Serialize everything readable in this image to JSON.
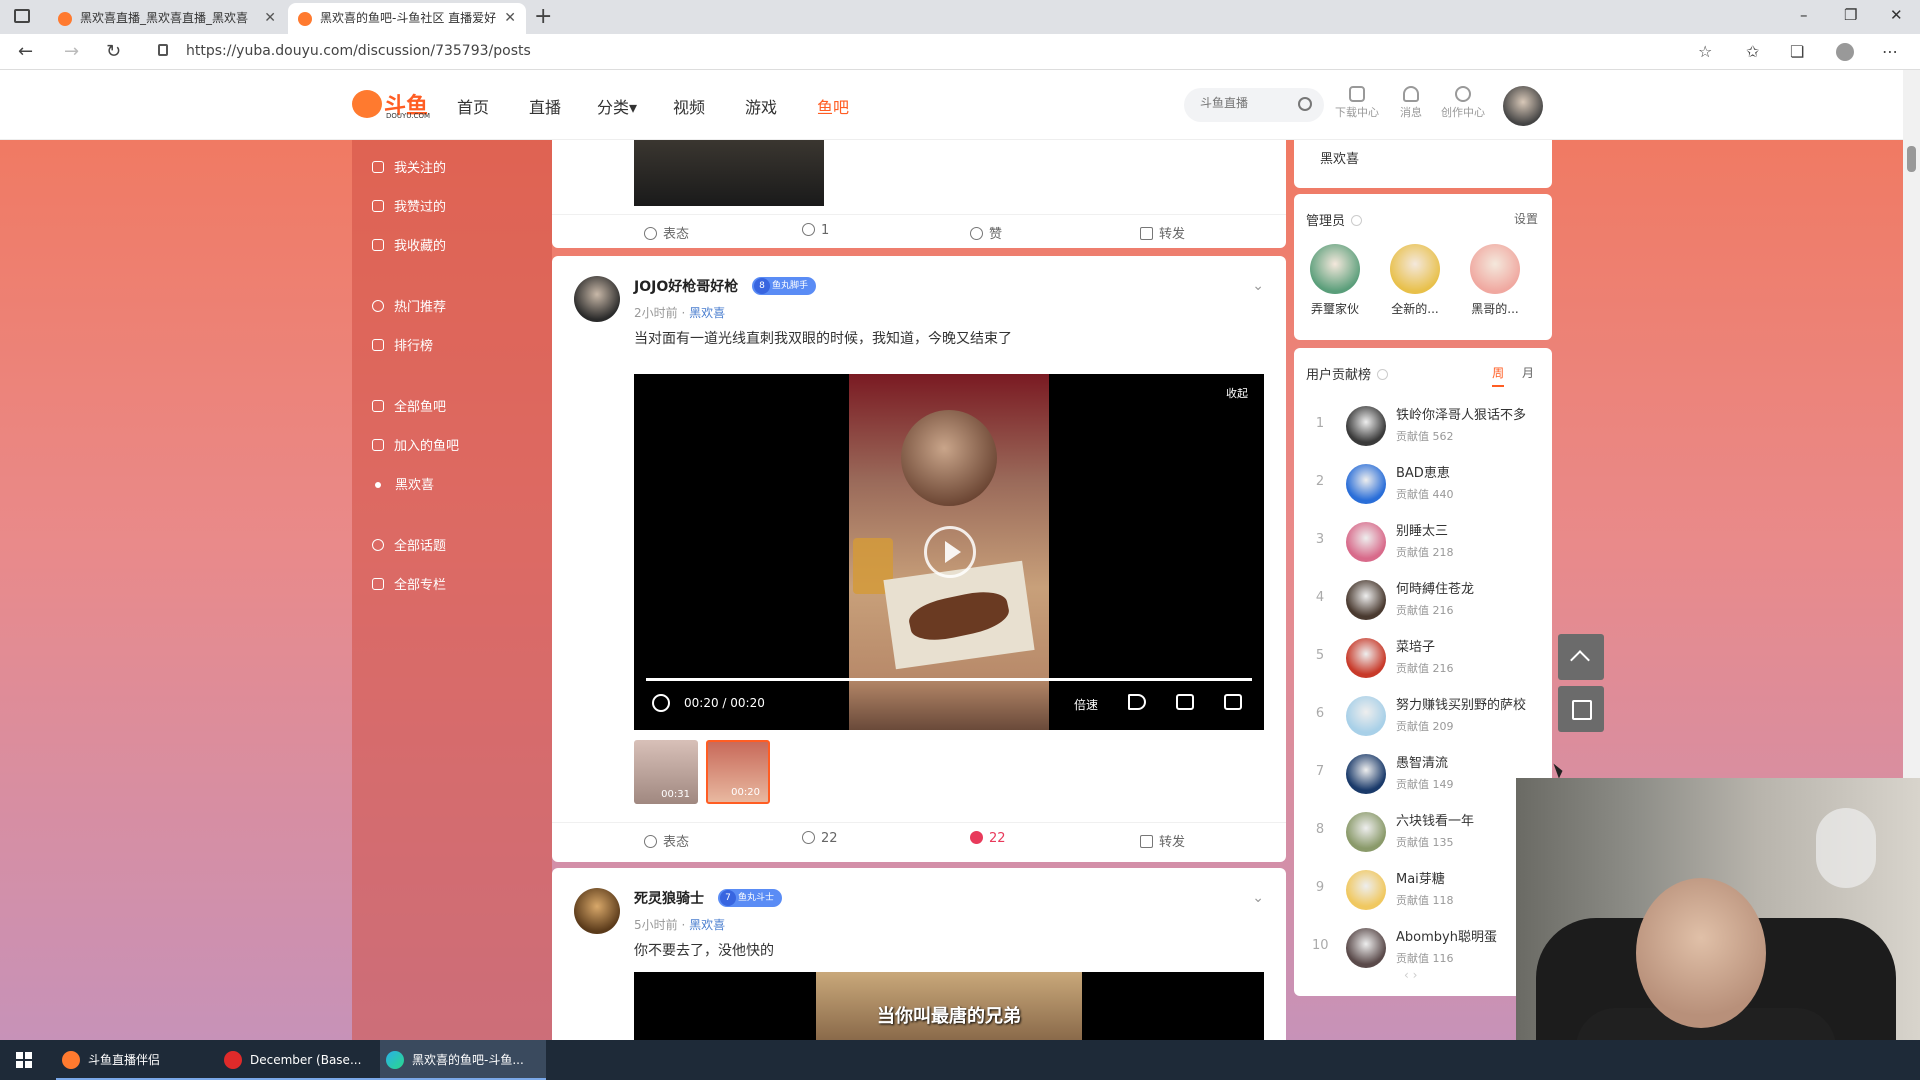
{
  "browser": {
    "tabs": [
      {
        "title": "黑欢喜直播_黑欢喜直播_黑欢喜",
        "active": false
      },
      {
        "title": "黑欢喜的鱼吧-斗鱼社区 直播爱好",
        "active": true
      }
    ],
    "url": "https://yuba.douyu.com/discussion/735793/posts",
    "window_controls": {
      "minimize": "–",
      "restore": "❐",
      "close": "✕"
    }
  },
  "header": {
    "logo_text": "斗鱼",
    "logo_sub": "DOUYU.COM",
    "nav": [
      "首页",
      "直播",
      "分类▾",
      "视频",
      "游戏",
      "鱼吧"
    ],
    "search_placeholder": "斗鱼直播",
    "tools": [
      "下载中心",
      "消息",
      "创作中心"
    ]
  },
  "sidebar": {
    "items": [
      "我关注的",
      "我赞过的",
      "我收藏的",
      "热门推荐",
      "排行榜",
      "全部鱼吧",
      "加入的鱼吧",
      "黑欢喜",
      "全部话题",
      "全部专栏"
    ]
  },
  "feed": {
    "post0": {
      "actions": {
        "react": "表态",
        "comments": "1",
        "like": "赞",
        "share": "转发"
      }
    },
    "post1": {
      "author": "JOJO好枪哥好枪",
      "badge_level": "8",
      "badge_name": "鱼丸脚手",
      "time": "2小时前",
      "separator": "·",
      "bar": "黑欢喜",
      "text": "当对面有一道光线直刺我双眼的时候，我知道，今晚又结束了",
      "video": {
        "collapse_label": "收起",
        "time_text": "00:20 / 00:20",
        "progress": 1.0,
        "speed_label": "倍速",
        "thumbs": [
          {
            "duration": "00:31"
          },
          {
            "duration": "00:20"
          }
        ]
      },
      "actions": {
        "react": "表态",
        "comments": "22",
        "likes": "22",
        "share": "转发"
      }
    },
    "post2": {
      "author": "死灵狼骑士",
      "badge_level": "7",
      "badge_name": "鱼丸斗士",
      "time": "5小时前",
      "separator": "·",
      "bar": "黑欢喜",
      "text": "你不要去了，没他快的",
      "video_subtitle": "当你叫最唐的兄弟"
    }
  },
  "right": {
    "top_label": "黑欢喜",
    "admins": {
      "title": "管理员",
      "settings": "设置",
      "list": [
        {
          "name": "弄璽家伙",
          "color": "#5a9e7a"
        },
        {
          "name": "全新的...",
          "color": "#e8c04a"
        },
        {
          "name": "黑哥的...",
          "color": "#f0a8a0"
        }
      ]
    },
    "ranking": {
      "title": "用户贡献榜",
      "tab_week": "周",
      "tab_month": "月",
      "score_label": "贡献值",
      "pager": "‹   ›",
      "list": [
        {
          "rank": "1",
          "name": "铁岭你泽哥人狠话不多",
          "score": "562",
          "color": "#3a3a3a"
        },
        {
          "rank": "2",
          "name": "BAD恵恵",
          "score": "440",
          "color": "#2a6ed8"
        },
        {
          "rank": "3",
          "name": "别睡太三",
          "score": "218",
          "color": "#d86a8a"
        },
        {
          "rank": "4",
          "name": "何時縛住苍龙",
          "score": "216",
          "color": "#4a3a30"
        },
        {
          "rank": "5",
          "name": "菜培子",
          "score": "216",
          "color": "#c83a2a"
        },
        {
          "rank": "6",
          "name": "努力赚钱买别野的萨校",
          "score": "209",
          "color": "#a8d0e8"
        },
        {
          "rank": "7",
          "name": "愚智清流",
          "score": "149",
          "color": "#1a3a6a"
        },
        {
          "rank": "8",
          "name": "六块钱看一年",
          "score": "135",
          "color": "#8a9a6a"
        },
        {
          "rank": "9",
          "name": "Mai芽糖",
          "score": "118",
          "color": "#f0c860"
        },
        {
          "rank": "10",
          "name": "Abombyh聪明蛋",
          "score": "116",
          "color": "#5a4a4a"
        }
      ]
    }
  },
  "taskbar": {
    "items": [
      "斗鱼直播伴侣",
      "December (Base...",
      "黑欢喜的鱼吧-斗鱼..."
    ]
  }
}
